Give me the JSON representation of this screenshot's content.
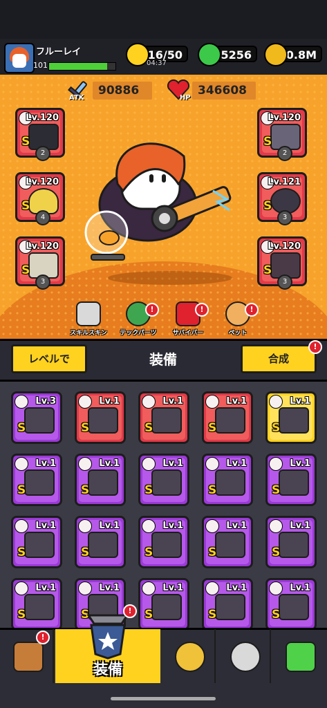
{
  "player": {
    "name": "フルーレイ",
    "level": "101",
    "xp_fraction": 0.88
  },
  "resources": {
    "energy": "16/50",
    "energy_timer": "04:37",
    "gems": "15256",
    "coins": "70.8M"
  },
  "stats": {
    "atk_label": "ATK",
    "atk": "90886",
    "hp_label": "HP",
    "hp": "346608"
  },
  "equipped_left": [
    {
      "level": "Lv.120",
      "rank": "S",
      "tier": "2"
    },
    {
      "level": "Lv.120",
      "rank": "S",
      "tier": "4"
    },
    {
      "level": "Lv.120",
      "rank": "S",
      "tier": "3"
    }
  ],
  "equipped_right": [
    {
      "level": "Lv.120",
      "rank": "S",
      "tier": "2"
    },
    {
      "level": "Lv.121",
      "rank": "S",
      "tier": "3"
    },
    {
      "level": "Lv.120",
      "rank": "S",
      "tier": "3"
    }
  ],
  "hero_tabs": [
    {
      "label": "スキルスキン"
    },
    {
      "label": "テックパーツ"
    },
    {
      "label": "サバイバー"
    },
    {
      "label": "ペット"
    }
  ],
  "equipment_bar": {
    "sort_button": "レベルで",
    "title": "装備",
    "merge_button": "合成",
    "badge": "!"
  },
  "inventory": [
    {
      "level": "Lv.3",
      "rank": "S",
      "color": "purple"
    },
    {
      "level": "Lv.1",
      "rank": "S",
      "color": "red"
    },
    {
      "level": "Lv.1",
      "rank": "S",
      "color": "red"
    },
    {
      "level": "Lv.1",
      "rank": "S",
      "color": "red"
    },
    {
      "level": "Lv.1",
      "rank": "S",
      "color": "yellow"
    },
    {
      "level": "Lv.1",
      "rank": "S",
      "color": "purple"
    },
    {
      "level": "Lv.1",
      "rank": "S",
      "color": "purple"
    },
    {
      "level": "Lv.1",
      "rank": "S",
      "color": "purple"
    },
    {
      "level": "Lv.1",
      "rank": "S",
      "color": "purple"
    },
    {
      "level": "Lv.1",
      "rank": "S",
      "color": "purple"
    },
    {
      "level": "Lv.1",
      "rank": "S",
      "color": "purple"
    },
    {
      "level": "Lv.1",
      "rank": "S",
      "color": "purple"
    },
    {
      "level": "Lv.1",
      "rank": "S",
      "color": "purple"
    },
    {
      "level": "Lv.1",
      "rank": "S",
      "color": "purple"
    },
    {
      "level": "Lv.1",
      "rank": "S",
      "color": "purple"
    },
    {
      "level": "Lv.1",
      "rank": "S",
      "color": "purple"
    },
    {
      "level": "Lv.1",
      "rank": "S",
      "color": "purple"
    },
    {
      "level": "Lv.1",
      "rank": "S",
      "color": "purple"
    },
    {
      "level": "Lv.1",
      "rank": "S",
      "color": "purple"
    },
    {
      "level": "Lv.1",
      "rank": "S",
      "color": "purple"
    }
  ],
  "nav": {
    "active_label": "装備",
    "badge": "!"
  },
  "colors": {
    "purple": "#9a3ad6",
    "red": "#e23a49",
    "yellow": "#ffd21f",
    "orange": "#f7a32b"
  }
}
